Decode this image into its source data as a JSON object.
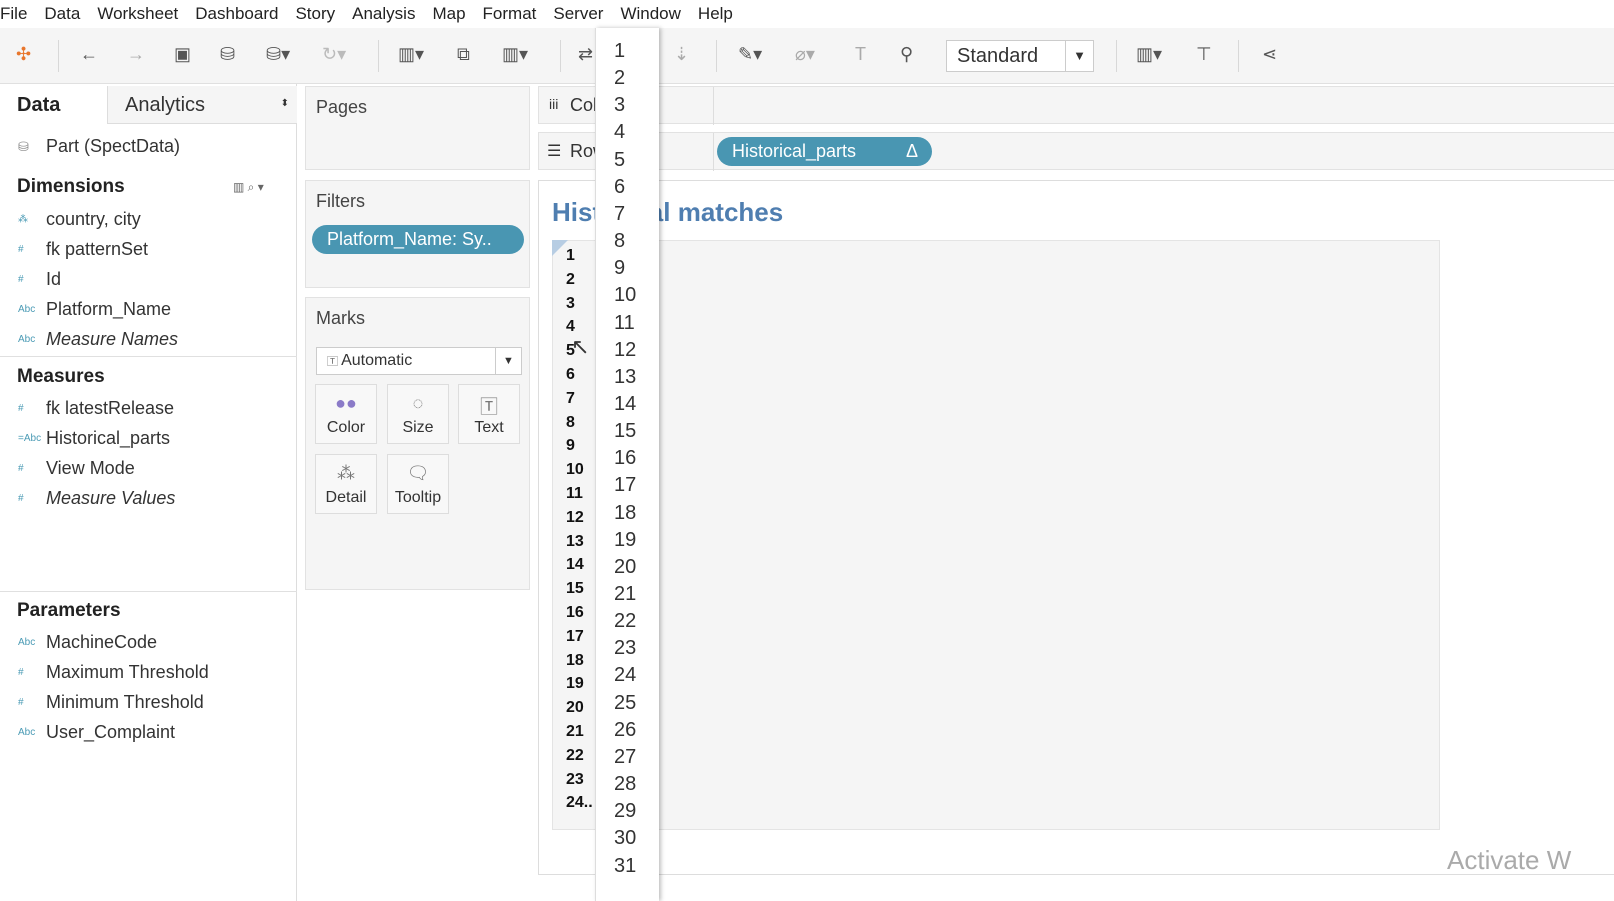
{
  "menu": [
    "File",
    "Data",
    "Worksheet",
    "Dashboard",
    "Story",
    "Analysis",
    "Map",
    "Format",
    "Server",
    "Window",
    "Help"
  ],
  "toolbar": {
    "fit_select": "Standard",
    "icons": [
      "tableau-logo-icon",
      "undo-icon",
      "redo-icon",
      "save-icon",
      "new-datasource-icon",
      "pause-update-icon",
      "refresh-icon",
      "new-worksheet-icon",
      "duplicate-sheet-icon",
      "clear-sheet-icon",
      "swap-icon",
      "sort-icon",
      "highlight-icon",
      "annotate-icon",
      "label-icon",
      "pin-icon",
      "show-cards-icon",
      "presentation-icon",
      "share-icon"
    ]
  },
  "left": {
    "tabs": [
      "Data",
      "Analytics"
    ],
    "datasource": "Part (SpectData)",
    "dimensions_label": "Dimensions",
    "dimensions": [
      {
        "icon": "geo",
        "label": "country, city"
      },
      {
        "icon": "#",
        "label": "fk patternSet"
      },
      {
        "icon": "#",
        "label": "Id"
      },
      {
        "icon": "Abc",
        "label": "Platform_Name"
      },
      {
        "icon": "Abc",
        "label": "Measure Names",
        "italic": true
      }
    ],
    "measures_label": "Measures",
    "measures": [
      {
        "icon": "#",
        "label": "fk latestRelease"
      },
      {
        "icon": "=Abc",
        "label": "Historical_parts"
      },
      {
        "icon": "#",
        "label": "View Mode"
      },
      {
        "icon": "#",
        "label": "Measure Values",
        "italic": true
      }
    ],
    "parameters_label": "Parameters",
    "parameters": [
      {
        "icon": "Abc",
        "label": "MachineCode"
      },
      {
        "icon": "#",
        "label": "Maximum Threshold"
      },
      {
        "icon": "#",
        "label": "Minimum Threshold"
      },
      {
        "icon": "Abc",
        "label": "User_Complaint"
      }
    ]
  },
  "cards": {
    "pages": "Pages",
    "filters": "Filters",
    "filter_pill": "Platform_Name: Sy..",
    "marks": "Marks",
    "mark_type": "Automatic",
    "mark_buttons": [
      "Color",
      "Size",
      "Text",
      "Detail",
      "Tooltip"
    ]
  },
  "shelves": {
    "columns": "Columns",
    "rows": "Rows",
    "rows_pill": "Historical_parts",
    "pill_delta": "Δ"
  },
  "view": {
    "title": "Historical matches",
    "row_headers": [
      "1",
      "2",
      "3",
      "4",
      "5",
      "6",
      "7",
      "8",
      "9",
      "10",
      "11",
      "12",
      "13",
      "14",
      "15",
      "16",
      "17",
      "18",
      "19",
      "20",
      "21",
      "22",
      "23",
      "24.."
    ]
  },
  "dropdown": [
    "1",
    "2",
    "3",
    "4",
    "5",
    "6",
    "7",
    "8",
    "9",
    "10",
    "11",
    "12",
    "13",
    "14",
    "15",
    "16",
    "17",
    "18",
    "19",
    "20",
    "21",
    "22",
    "23",
    "24",
    "25",
    "26",
    "27",
    "28",
    "29",
    "30",
    "31"
  ],
  "watermark": "Activate W"
}
